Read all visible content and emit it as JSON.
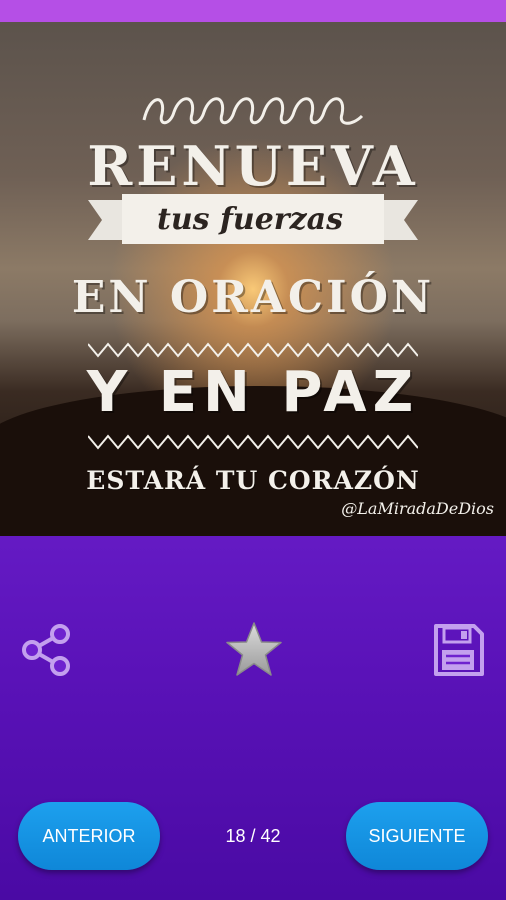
{
  "image": {
    "lines": {
      "line1": "RENUEVA",
      "line2": "tus fuerzas",
      "line3": "EN ORACIÓN",
      "line4": "Y EN PAZ",
      "line5": "ESTARÁ TU CORAZÓN"
    },
    "watermark": "@LaMiradaDeDios"
  },
  "actions": {
    "share_icon": "share-icon",
    "favorite_icon": "star-icon",
    "save_icon": "floppy-disk-icon"
  },
  "navigation": {
    "prev_label": "ANTERIOR",
    "next_label": "SIGUIENTE",
    "page_counter": "18 / 42"
  },
  "colors": {
    "status_bar": "#b54fe6",
    "background": "#6e22cf",
    "button": "#1a98e8",
    "icon": "#c3a0ee",
    "star": "#b8b8b8"
  }
}
